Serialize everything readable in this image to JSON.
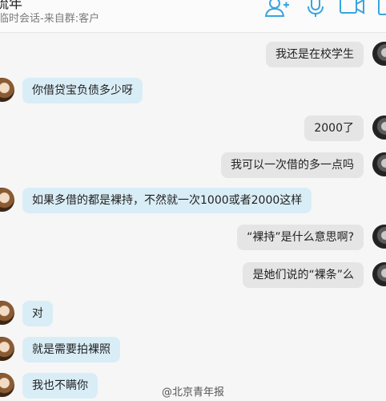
{
  "header": {
    "title": "琉年",
    "subtitle": "临时会话-来自群:客户"
  },
  "messages": [
    {
      "dir": "out",
      "text": "我还是在校学生"
    },
    {
      "dir": "in",
      "text": "你借贷宝负债多少呀"
    },
    {
      "dir": "out",
      "text": "2000了"
    },
    {
      "dir": "out",
      "text": "我可以一次借的多一点吗"
    },
    {
      "dir": "in",
      "text": "如果多借的都是裸持，不然就一次1000或者2000这样"
    },
    {
      "dir": "out",
      "text": "“裸持”是什么意思啊?"
    },
    {
      "dir": "out",
      "text": "是她们说的“裸条”么"
    },
    {
      "dir": "in",
      "text": "对"
    },
    {
      "dir": "in",
      "text": "就是需要拍裸照"
    },
    {
      "dir": "in",
      "text": "我也不瞒你"
    }
  ],
  "watermark": "@北京青年报",
  "colors": {
    "incoming": "#d9edf7",
    "outgoing": "#e5e5e5",
    "icon": "#3aa4e0"
  },
  "icons": [
    "add-contact-icon",
    "microphone-icon",
    "video-call-icon",
    "more-icon"
  ]
}
